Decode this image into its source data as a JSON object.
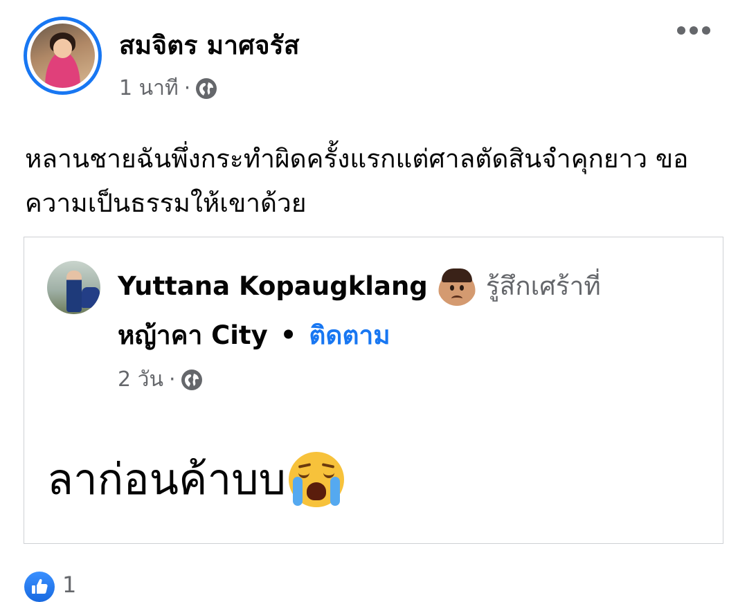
{
  "post": {
    "author": "สมจิตร มาศจรัส",
    "time": "1 นาที",
    "separator": "·",
    "text": "หลานชายฉันพึ่งกระทำผิดครั้งแรกแต่ศาลตัดสินจำคุกยาว ขอความเป็นธรรมให้เขาด้วย"
  },
  "shared_post": {
    "author": "Yuttana Kopaugklang",
    "feeling": "รู้สึกเศร้าที่",
    "location": "หญ้าคา City",
    "dot": "•",
    "follow_label": "ติดตาม",
    "time": "2 วัน",
    "separator": "·",
    "text": "ลาก่อนค้าบบ"
  },
  "reactions": {
    "like_count": "1"
  },
  "icons": {
    "privacy": "globe-icon",
    "menu": "more-options-icon",
    "feeling": "sad-face-emoji",
    "message_emoji": "crying-face-emoji",
    "reaction": "like-icon"
  },
  "colors": {
    "accent": "#1877f2",
    "secondary_text": "#65676b"
  }
}
